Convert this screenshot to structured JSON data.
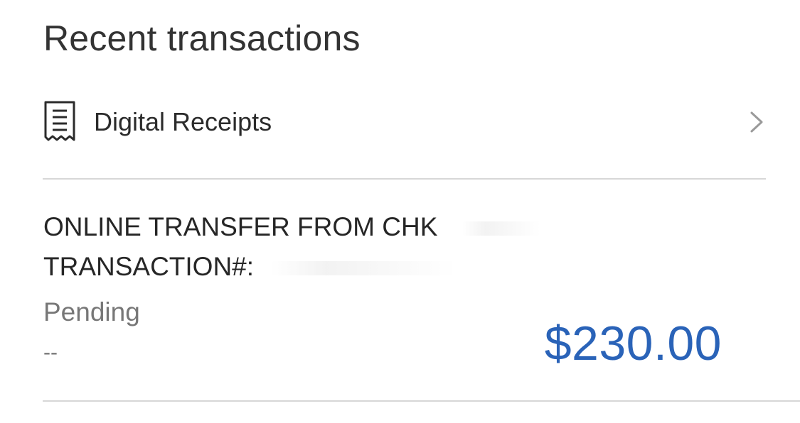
{
  "section": {
    "title": "Recent transactions"
  },
  "receipts": {
    "label": "Digital Receipts",
    "icon": "receipt-icon",
    "chevron_icon": "chevron-right-icon"
  },
  "transaction": {
    "description_line1": "ONLINE TRANSFER FROM CHK",
    "description_line2": "TRANSACTION#:",
    "status": "Pending",
    "date": "--",
    "amount": "$230.00"
  },
  "colors": {
    "amount": "#2a63b8",
    "divider": "#d7d7d7",
    "muted_text": "#777777"
  }
}
